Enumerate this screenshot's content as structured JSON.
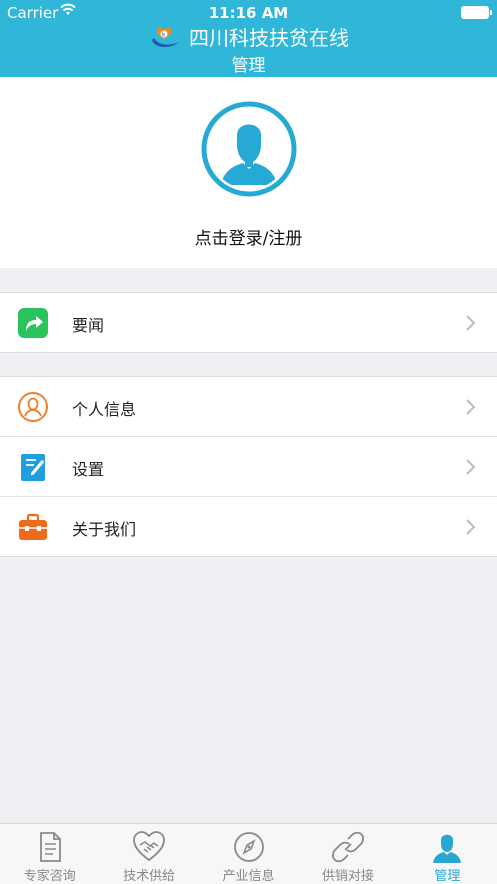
{
  "status_bar": {
    "carrier": "Carrier",
    "time": "11:16 AM"
  },
  "header": {
    "app_title": "四川科技扶贫在线",
    "page_title": "管理"
  },
  "profile": {
    "login_text": "点击登录/注册"
  },
  "groups": [
    {
      "items": [
        {
          "label": "要闻",
          "icon": "share-arrow-icon"
        }
      ]
    },
    {
      "items": [
        {
          "label": "个人信息",
          "icon": "person-circle-icon"
        },
        {
          "label": "设置",
          "icon": "edit-note-icon"
        },
        {
          "label": "关于我们",
          "icon": "toolbox-icon"
        }
      ]
    }
  ],
  "tabs": [
    {
      "label": "专家咨询",
      "icon": "document-icon",
      "active": false
    },
    {
      "label": "技术供给",
      "icon": "handshake-heart-icon",
      "active": false
    },
    {
      "label": "产业信息",
      "icon": "compass-icon",
      "active": false
    },
    {
      "label": "供销对接",
      "icon": "link-icon",
      "active": false
    },
    {
      "label": "管理",
      "icon": "person-icon",
      "active": true
    }
  ],
  "colors": {
    "header": "#2fb6d9",
    "accent": "#2aa6d1",
    "background": "#efeff4"
  }
}
